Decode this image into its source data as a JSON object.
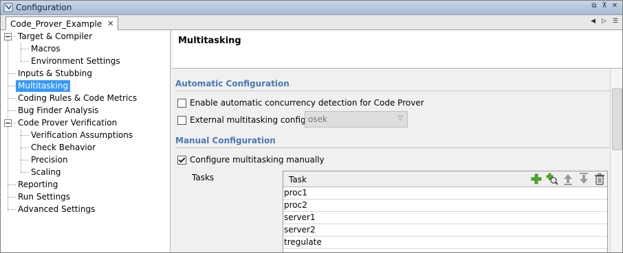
{
  "window": {
    "title": "Configuration",
    "controls": [
      "restore",
      "pin",
      "close"
    ]
  },
  "tab": {
    "label": "Code_Prover_Example",
    "close_glyph": "✕"
  },
  "tree": {
    "items": [
      {
        "label": "Target & Compiler"
      },
      {
        "label": "Macros"
      },
      {
        "label": "Environment Settings"
      },
      {
        "label": "Inputs & Stubbing"
      },
      {
        "label": "Multitasking",
        "selected": true
      },
      {
        "label": "Coding Rules & Code Metrics"
      },
      {
        "label": "Bug Finder Analysis"
      },
      {
        "label": "Code Prover Verification"
      },
      {
        "label": "Verification Assumptions"
      },
      {
        "label": "Check Behavior"
      },
      {
        "label": "Precision"
      },
      {
        "label": "Scaling"
      },
      {
        "label": "Reporting"
      },
      {
        "label": "Run Settings"
      },
      {
        "label": "Advanced Settings"
      }
    ]
  },
  "panel": {
    "title": "Multitasking",
    "automatic": {
      "title": "Automatic Configuration",
      "enable_label": "Enable automatic concurrency detection for Code Prover",
      "enable_checked": false,
      "external_label": "External multitasking configuration",
      "external_checked": false,
      "external_value": "osek"
    },
    "manual": {
      "title": "Manual Configuration",
      "configure_label": "Configure multitasking manually",
      "configure_checked": true,
      "tasks_label": "Tasks",
      "column_header": "Task",
      "tasks": [
        "proc1",
        "proc2",
        "server1",
        "server2",
        "tregulate"
      ]
    }
  },
  "colors": {
    "selection": "#3399ff",
    "section_title": "#4a78b5",
    "add_icon": "#4caf1f"
  }
}
